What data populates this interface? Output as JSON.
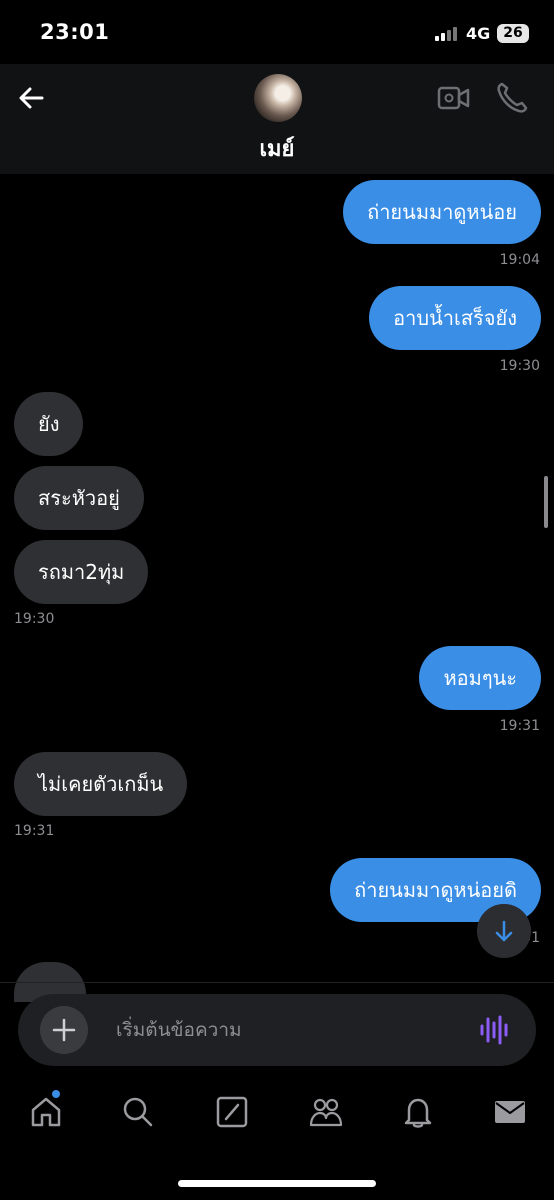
{
  "status_bar": {
    "time": "23:01",
    "network": "4G",
    "battery": "26"
  },
  "header": {
    "contact_name": "เมย์"
  },
  "messages": [
    {
      "text": "ถ่ายนมมาดูหน่อย",
      "time": "19:04"
    },
    {
      "text": "อาบน้ำเสร็จยัง",
      "time": "19:30"
    },
    {
      "text": "ยัง"
    },
    {
      "text": "สระหัวอยู่"
    },
    {
      "text": "รถมา2ทุ่ม",
      "time": "19:30"
    },
    {
      "text": "หอมๆนะ",
      "time": "19:31"
    },
    {
      "text": "ไม่เคยตัวเกม็น",
      "time": "19:31"
    },
    {
      "text": "ถ่ายนมมาดูหน่อยดิ",
      "time": "19:31"
    }
  ],
  "composer": {
    "placeholder": "เริ่มต้นข้อความ"
  },
  "icons": {
    "back": "arrow-left-icon",
    "video": "video-call-icon",
    "phone": "phone-icon",
    "plus": "plus-icon",
    "voice": "voice-wave-icon",
    "scroll_down": "arrow-down-icon"
  },
  "nav": [
    "home-icon",
    "search-icon",
    "compose-icon",
    "communities-icon",
    "notifications-icon",
    "messages-icon"
  ],
  "colors": {
    "outgoing": "#3a8ee6",
    "incoming": "#2f3033",
    "accent": "#8b5cf6"
  }
}
